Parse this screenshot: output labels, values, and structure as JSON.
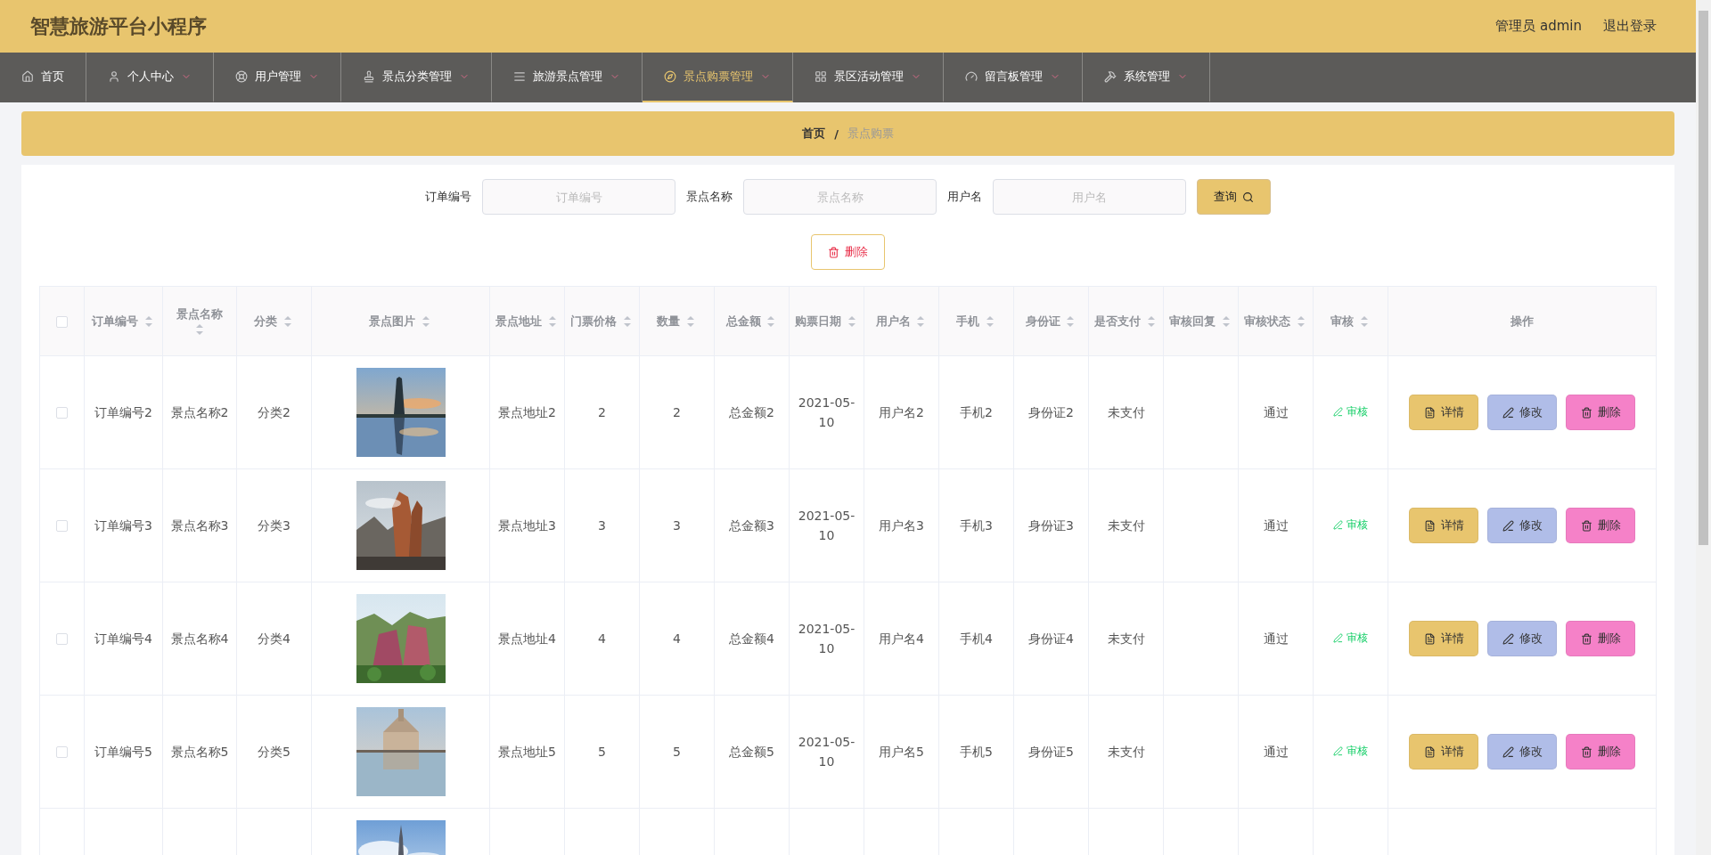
{
  "header": {
    "title": "智慧旅游平台小程序",
    "user": "管理员 admin",
    "logout": "退出登录"
  },
  "nav": [
    {
      "label": "首页",
      "selected": false
    },
    {
      "label": "个人中心",
      "selected": false
    },
    {
      "label": "用户管理",
      "selected": false
    },
    {
      "label": "景点分类管理",
      "selected": false
    },
    {
      "label": "旅游景点管理",
      "selected": false
    },
    {
      "label": "景点购票管理",
      "selected": true
    },
    {
      "label": "景区活动管理",
      "selected": false
    },
    {
      "label": "留言板管理",
      "selected": false
    },
    {
      "label": "系统管理",
      "selected": false
    }
  ],
  "breadcrumb": {
    "items": [
      "首页",
      "景点购票"
    ],
    "separator": "/"
  },
  "search": {
    "fields": [
      {
        "label": "订单编号",
        "placeholder": "订单编号"
      },
      {
        "label": "景点名称",
        "placeholder": "景点名称"
      },
      {
        "label": "用户名",
        "placeholder": "用户名"
      }
    ],
    "button": "查询"
  },
  "bulk_delete": "删除",
  "table": {
    "select_all_checked": false,
    "columns": [
      "订单编号",
      "景点名称",
      "分类",
      "景点图片",
      "景点地址",
      "门票价格",
      "数量",
      "总金额",
      "购票日期",
      "用户名",
      "手机",
      "身份证",
      "是否支付",
      "审核回复",
      "审核状态",
      "审核",
      "操作"
    ],
    "rows": [
      {
        "checked": false,
        "cells": [
          "订单编号2",
          "景点名称2",
          "分类2",
          "",
          "景点地址2",
          "2",
          "2",
          "总金额2",
          "2021-05-10",
          "用户名2",
          "手机2",
          "身份证2",
          "未支付",
          "",
          "通过"
        ],
        "image": {
          "kind": "picture"
        },
        "audit": "审核",
        "actions": [
          "详情",
          "修改",
          "删除"
        ]
      },
      {
        "checked": false,
        "cells": [
          "订单编号3",
          "景点名称3",
          "分类3",
          "",
          "景点地址3",
          "3",
          "3",
          "总金额3",
          "2021-05-10",
          "用户名3",
          "手机3",
          "身份证3",
          "未支付",
          "",
          "通过"
        ],
        "image": {
          "kind": "picture"
        },
        "audit": "审核",
        "actions": [
          "详情",
          "修改",
          "删除"
        ]
      },
      {
        "checked": false,
        "cells": [
          "订单编号4",
          "景点名称4",
          "分类4",
          "",
          "景点地址4",
          "4",
          "4",
          "总金额4",
          "2021-05-10",
          "用户名4",
          "手机4",
          "身份证4",
          "未支付",
          "",
          "通过"
        ],
        "image": {
          "kind": "picture"
        },
        "audit": "审核",
        "actions": [
          "详情",
          "修改",
          "删除"
        ]
      },
      {
        "checked": false,
        "cells": [
          "订单编号5",
          "景点名称5",
          "分类5",
          "",
          "景点地址5",
          "5",
          "5",
          "总金额5",
          "2021-05-10",
          "用户名5",
          "手机5",
          "身份证5",
          "未支付",
          "",
          "通过"
        ],
        "image": {
          "kind": "picture"
        },
        "audit": "审核",
        "actions": [
          "详情",
          "修改",
          "删除"
        ]
      },
      {
        "image": {
          "kind": "picture"
        }
      }
    ]
  }
}
